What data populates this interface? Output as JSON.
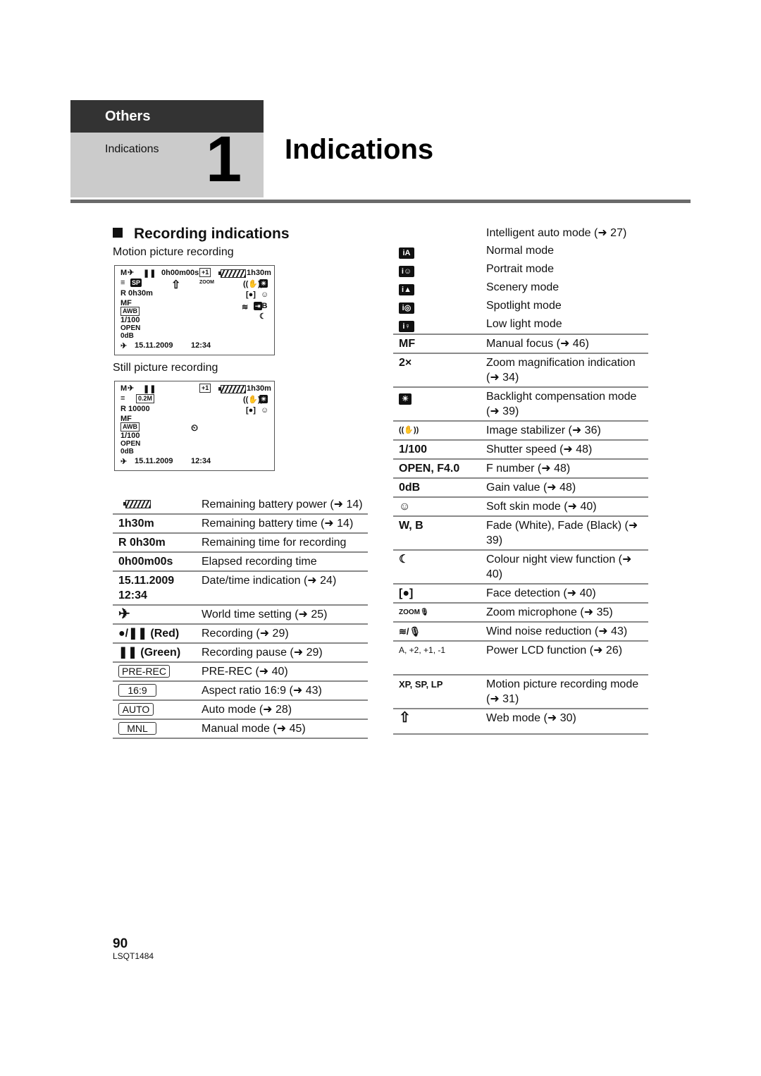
{
  "header": {
    "section": "Others",
    "subsection": "Indications",
    "chapter_number": "1",
    "title": "Indications"
  },
  "section_title": "Recording indications",
  "motion_label": "Motion picture recording",
  "still_label": "Still picture recording",
  "lcd_motion": {
    "mode": "M",
    "pause": "❚❚",
    "elapsed": "0h00m00s",
    "lcd": "+1",
    "battery_time": "1h30m",
    "rec_mode": "SP",
    "remaining": "R  0h30m",
    "zoom_mic": "ZOOM",
    "mf": "MF",
    "awb": "AWB",
    "shutter": "1/100",
    "iris": "OPEN",
    "gain": "0dB",
    "date": "15.11.2009",
    "time": "12:34",
    "fade": "B"
  },
  "lcd_still": {
    "mode": "M",
    "pause": "❚❚",
    "lcd": "+1",
    "battery_time": "1h30m",
    "size": "0.2M",
    "remaining": "R  10000",
    "mf": "MF",
    "awb": "AWB",
    "shutter": "1/100",
    "iris": "OPEN",
    "gain": "0dB",
    "date": "15.11.2009",
    "time": "12:34"
  },
  "left_table": [
    {
      "icon": "battery-icon",
      "label": "",
      "desc": "Remaining battery power (➜ 14)"
    },
    {
      "label": "1h30m",
      "desc": "Remaining battery time (➜ 14)"
    },
    {
      "label": "R  0h30m",
      "desc": "Remaining time for recording"
    },
    {
      "label": "0h00m00s",
      "desc": "Elapsed recording time"
    },
    {
      "label": "15.11.2009 12:34",
      "desc": "Date/time indication (➜ 24)"
    },
    {
      "icon": "airplane-icon",
      "label": "✈",
      "desc": "World time setting (➜ 25)"
    },
    {
      "label": "●/❚❚ (Red)",
      "desc": "Recording (➜ 29)"
    },
    {
      "label": "❚❚ (Green)",
      "desc": "Recording pause (➜ 29)"
    },
    {
      "label": "PRE-REC",
      "boxed": true,
      "desc": "PRE-REC (➜ 40)"
    },
    {
      "label": "16:9",
      "boxed": true,
      "desc": "Aspect ratio 16:9 (➜ 43)"
    },
    {
      "label": "AUTO",
      "boxed": true,
      "desc": "Auto mode (➜ 28)"
    },
    {
      "label": "MNL",
      "boxed": true,
      "desc": "Manual mode (➜ 45)"
    }
  ],
  "right_table": [
    {
      "label": "",
      "desc": "Intelligent auto mode (➜ 27)"
    },
    {
      "icon": "ia-normal-icon",
      "label": "iA",
      "desc": "Normal mode"
    },
    {
      "icon": "ia-portrait-icon",
      "label": "i☺",
      "desc": "Portrait mode"
    },
    {
      "icon": "ia-scenery-icon",
      "label": "i▲",
      "desc": "Scenery mode"
    },
    {
      "icon": "ia-spotlight-icon",
      "label": "i◎",
      "desc": "Spotlight mode"
    },
    {
      "icon": "ia-lowlight-icon",
      "label": "i♀",
      "desc": "Low light mode"
    },
    {
      "label": "MF",
      "desc": "Manual focus (➜ 46)"
    },
    {
      "label": "2×",
      "desc": "Zoom magnification indication (➜ 34)"
    },
    {
      "icon": "backlight-icon",
      "label": "☀",
      "desc": "Backlight compensation mode (➜ 39)"
    },
    {
      "icon": "stabilizer-icon",
      "label": "((✋))",
      "desc": "Image stabilizer (➜ 36)"
    },
    {
      "label": "1/100",
      "desc": "Shutter speed (➜ 48)"
    },
    {
      "label": "OPEN, F4.0",
      "desc": "F number (➜ 48)"
    },
    {
      "label": "0dB",
      "desc": "Gain value (➜ 48)"
    },
    {
      "icon": "soft-skin-icon",
      "label": "☺",
      "desc": "Soft skin mode (➜ 40)"
    },
    {
      "icon": "fade-icon",
      "label": "W, B",
      "desc": "Fade (White), Fade (Black) (➜ 39)"
    },
    {
      "icon": "night-view-icon",
      "label": "☾",
      "desc": "Colour night view function (➜ 40)"
    },
    {
      "icon": "face-detection-icon",
      "label": "[●]",
      "desc": "Face detection (➜ 40)"
    },
    {
      "icon": "zoom-mic-icon",
      "label": "ZOOM🎙",
      "desc": "Zoom microphone (➜ 35)"
    },
    {
      "icon": "wind-noise-icon",
      "label": "≋/🎙",
      "desc": "Wind noise reduction (➜ 43)"
    },
    {
      "icon": "power-lcd-icon",
      "label": "A, +2, +1, -1",
      "desc": "Power LCD function (➜ 26)"
    },
    {
      "icon": "rec-mode-icon",
      "label": "XP, SP, LP",
      "desc": "Motion picture recording mode (➜ 31)"
    },
    {
      "icon": "web-mode-icon",
      "label": "⇧",
      "desc": "Web mode (➜ 30)"
    }
  ],
  "footer": {
    "page": "90",
    "code": "LSQT1484"
  }
}
